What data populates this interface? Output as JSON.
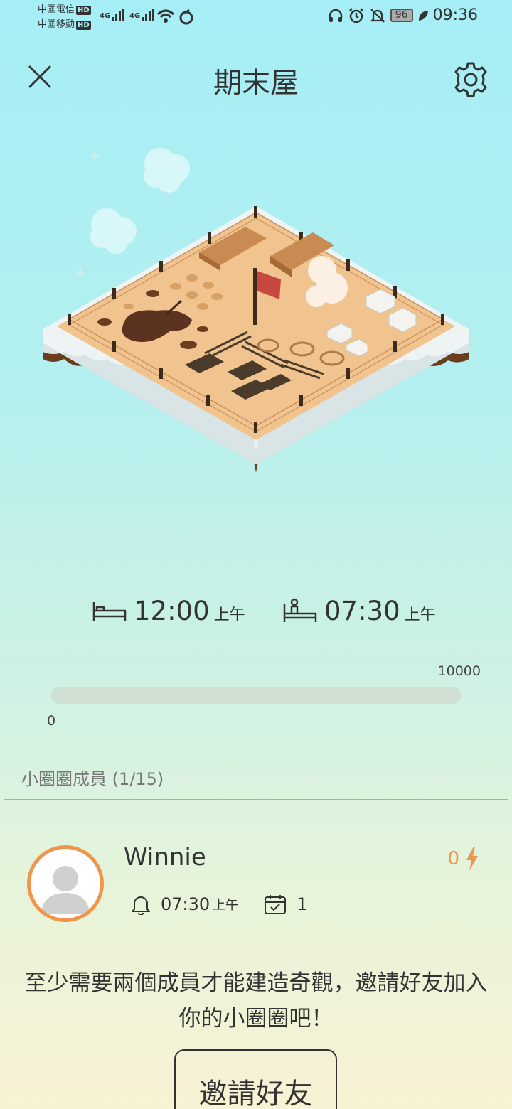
{
  "status_bar": {
    "carrier_1": "中國電信",
    "carrier_2": "中國移動",
    "hd_badge": "HD",
    "network_1": "4G",
    "network_2": "4G",
    "battery": "96",
    "time": "09:36"
  },
  "header": {
    "title": "期末屋"
  },
  "schedule": {
    "sleep_time": "12:00",
    "sleep_period": "上午",
    "wake_time": "07:30",
    "wake_period": "上午"
  },
  "progress": {
    "max_label": "10000",
    "min_label": "0",
    "value": 0
  },
  "members": {
    "label": "小圈圈成員 (1/15)",
    "items": [
      {
        "name": "Winnie",
        "energy": "0",
        "alarm_time": "07:30",
        "alarm_period": "上午",
        "days": "1"
      }
    ]
  },
  "invite": {
    "message": "至少需要兩個成員才能建造奇觀，邀請好友加入你的小圈圈吧！",
    "button_label": "邀請好友"
  },
  "colors": {
    "accent_orange": "#f0954a",
    "progress_track": "#cfe0d3",
    "sand": "#f1c48f",
    "snow": "#eef3f3",
    "soil": "#6b3d1f"
  }
}
